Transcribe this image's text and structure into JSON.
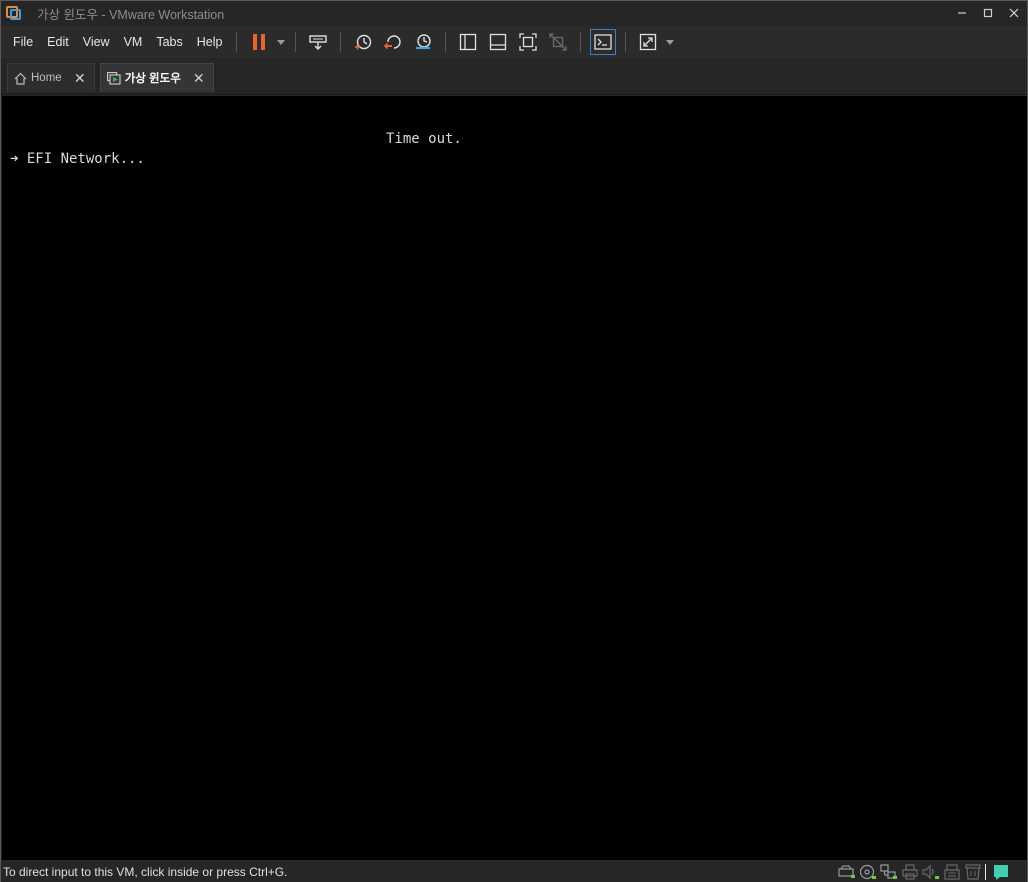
{
  "window": {
    "title": "가상 윈도우 - VMware Workstation",
    "controls": {
      "minimize": "–",
      "maximize": "□",
      "close": "✕"
    }
  },
  "menu": {
    "items": [
      {
        "label": "File"
      },
      {
        "label": "Edit"
      },
      {
        "label": "View"
      },
      {
        "label": "VM"
      },
      {
        "label": "Tabs"
      },
      {
        "label": "Help"
      }
    ]
  },
  "toolbar": {
    "icons": [
      "pause-icon",
      "send-ctrl-alt-del-icon",
      "take-snapshot-icon",
      "revert-snapshot-icon",
      "snapshot-manager-icon",
      "show-library-icon",
      "thumbnail-bar-icon",
      "full-screen-icon",
      "unity-icon",
      "console-view-icon",
      "stretch-guest-icon"
    ],
    "accent_pause": "#e8642c",
    "accent_snapshot": "#3aa0e0"
  },
  "tabs": [
    {
      "label": "Home",
      "close": "✕",
      "active": false
    },
    {
      "label": "가상 윈도우",
      "close": "✕",
      "active": true
    }
  ],
  "console": {
    "line1": "Time out.",
    "line2": "➜ EFI Network..."
  },
  "statusbar": {
    "text": "To direct input to this VM, click inside or press Ctrl+G.",
    "icons": [
      "hard-disk-icon",
      "cd-dvd-icon",
      "network-adapter-icon",
      "printer-icon",
      "sound-card-icon",
      "usb-icon",
      "floppy-icon",
      "message-icon"
    ]
  }
}
